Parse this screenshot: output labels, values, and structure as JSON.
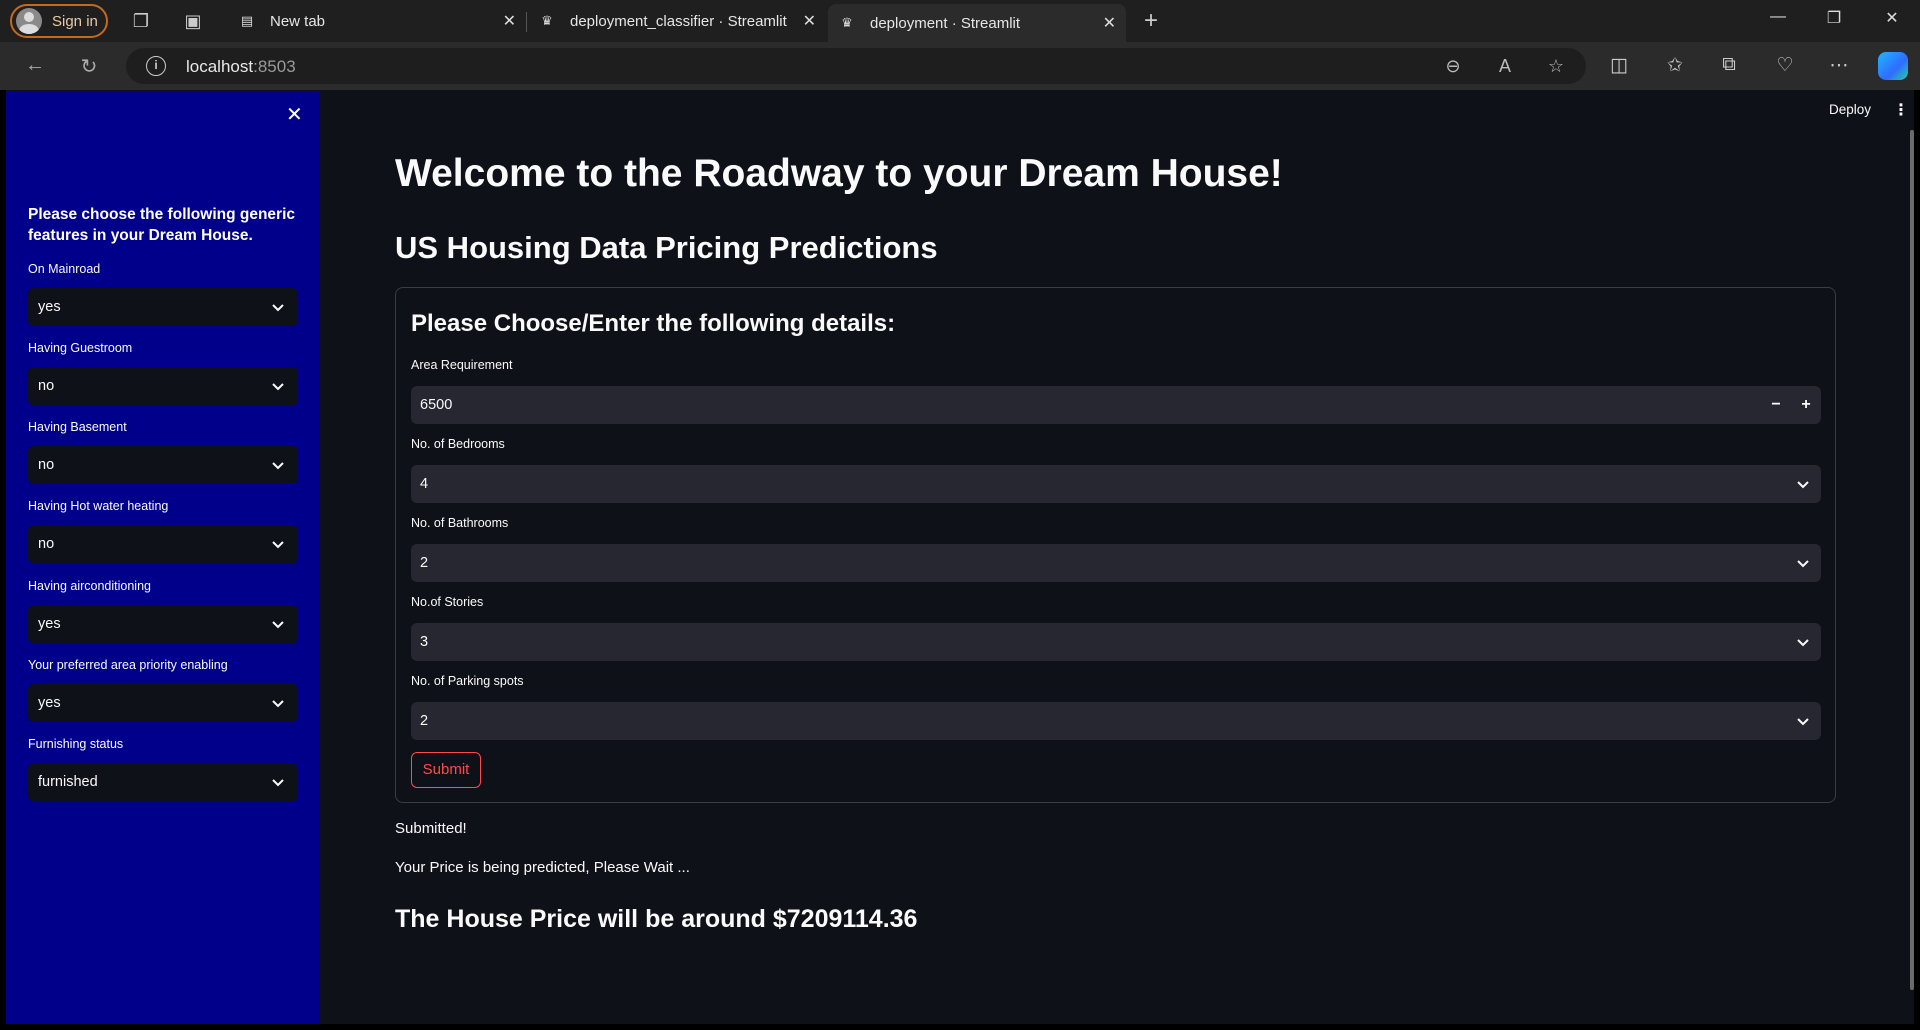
{
  "browser": {
    "signin_label": "Sign in",
    "tabs": [
      {
        "label": "New tab",
        "icon": "newtab-icon"
      },
      {
        "label": "deployment_classifier · Streamlit",
        "icon": "streamlit-crown-icon"
      },
      {
        "label": "deployment · Streamlit",
        "icon": "streamlit-crown-icon",
        "active": true
      }
    ],
    "url_host": "localhost",
    "url_port": ":8503"
  },
  "header": {
    "deploy_label": "Deploy"
  },
  "sidebar": {
    "heading": "Please choose the following generic features in your Dream House.",
    "fields": [
      {
        "label": "On Mainroad",
        "value": "yes"
      },
      {
        "label": "Having Guestroom",
        "value": "no"
      },
      {
        "label": "Having Basement",
        "value": "no"
      },
      {
        "label": "Having Hot water heating",
        "value": "no"
      },
      {
        "label": "Having airconditioning",
        "value": "yes"
      },
      {
        "label": "Your preferred area priority enabling",
        "value": "yes"
      },
      {
        "label": "Furnishing status",
        "value": "furnished"
      }
    ]
  },
  "main": {
    "title": "Welcome to the Roadway to your Dream House!",
    "subtitle": "US Housing Data Pricing Predictions",
    "form": {
      "title": "Please Choose/Enter the following details:",
      "area": {
        "label": "Area Requirement",
        "value": "6500",
        "minus": "−",
        "plus": "+"
      },
      "selects": [
        {
          "label": "No. of Bedrooms",
          "value": "4"
        },
        {
          "label": "No. of Bathrooms",
          "value": "2"
        },
        {
          "label": "No.of Stories",
          "value": "3"
        },
        {
          "label": "No. of Parking spots",
          "value": "2"
        }
      ],
      "submit_label": "Submit"
    },
    "submitted_msg": "Submitted!",
    "wait_msg": "Your Price is being predicted, Please Wait ...",
    "result": "The House Price will be around $7209114.36"
  },
  "colors": {
    "sidebar_bg": "#00008b",
    "app_bg": "#0e1117",
    "accent": "#ff4b4b",
    "input_bg": "#262730"
  }
}
